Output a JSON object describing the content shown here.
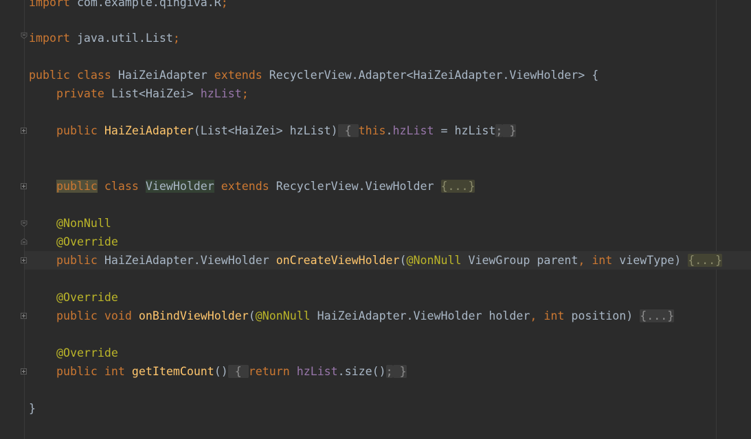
{
  "editor": {
    "line_import_r": {
      "kw": "import",
      "rest": " com.example.qingiva.R",
      "semi": ";"
    },
    "line_import_list": {
      "kw": "import",
      "rest": " java.util.List",
      "semi": ";"
    },
    "line_class": {
      "kw1": "public",
      "kw2": "class",
      "name": "HaiZeiAdapter",
      "kw3": "extends",
      "rest": "RecyclerView.Adapter<HaiZeiAdapter.ViewHolder> {"
    },
    "line_field": {
      "kw": "private",
      "type": "List<HaiZei>",
      "field": "hzList",
      "semi": ";"
    },
    "line_ctor": {
      "kw": "public",
      "name": "HaiZeiAdapter",
      "params": "(List<HaiZei> hzList)",
      "open": " { ",
      "this": "this",
      "dot": ".",
      "field": "hzList",
      "assign": " = hzList",
      "semi": ";",
      "close": " }"
    },
    "line_vh": {
      "kw1": "public",
      "kw2": "class",
      "name": "ViewHolder",
      "kw3": "extends",
      "rest": "RecyclerView.ViewHolder",
      "fold": "{...}"
    },
    "line_nonnull": {
      "ann": "@NonNull"
    },
    "line_override1": {
      "ann": "@Override"
    },
    "line_oncreate": {
      "kw": "public",
      "type": "HaiZeiAdapter.ViewHolder",
      "name": "onCreateViewHolder",
      "paren": "(",
      "ann": "@NonNull",
      "p1": " ViewGroup parent",
      "comma": ",",
      "kwint": "int",
      "p2": " viewType)",
      "fold": "{...}"
    },
    "line_override2": {
      "ann": "@Override"
    },
    "line_onbind": {
      "kw1": "public",
      "kw2": "void",
      "name": "onBindViewHolder",
      "paren": "(",
      "ann": "@NonNull",
      "p1": " HaiZeiAdapter.ViewHolder holder",
      "comma": ",",
      "kwint": "int",
      "p2": " position)",
      "fold": "{...}"
    },
    "line_override3": {
      "ann": "@Override"
    },
    "line_count": {
      "kw1": "public",
      "kw2": "int",
      "name": "getItemCount",
      "paren": "()",
      "open": " { ",
      "kwret": "return",
      "field": "hzList",
      "call": ".size()",
      "semi": ";",
      "close": " }"
    },
    "line_end": {
      "brace": "}"
    }
  }
}
